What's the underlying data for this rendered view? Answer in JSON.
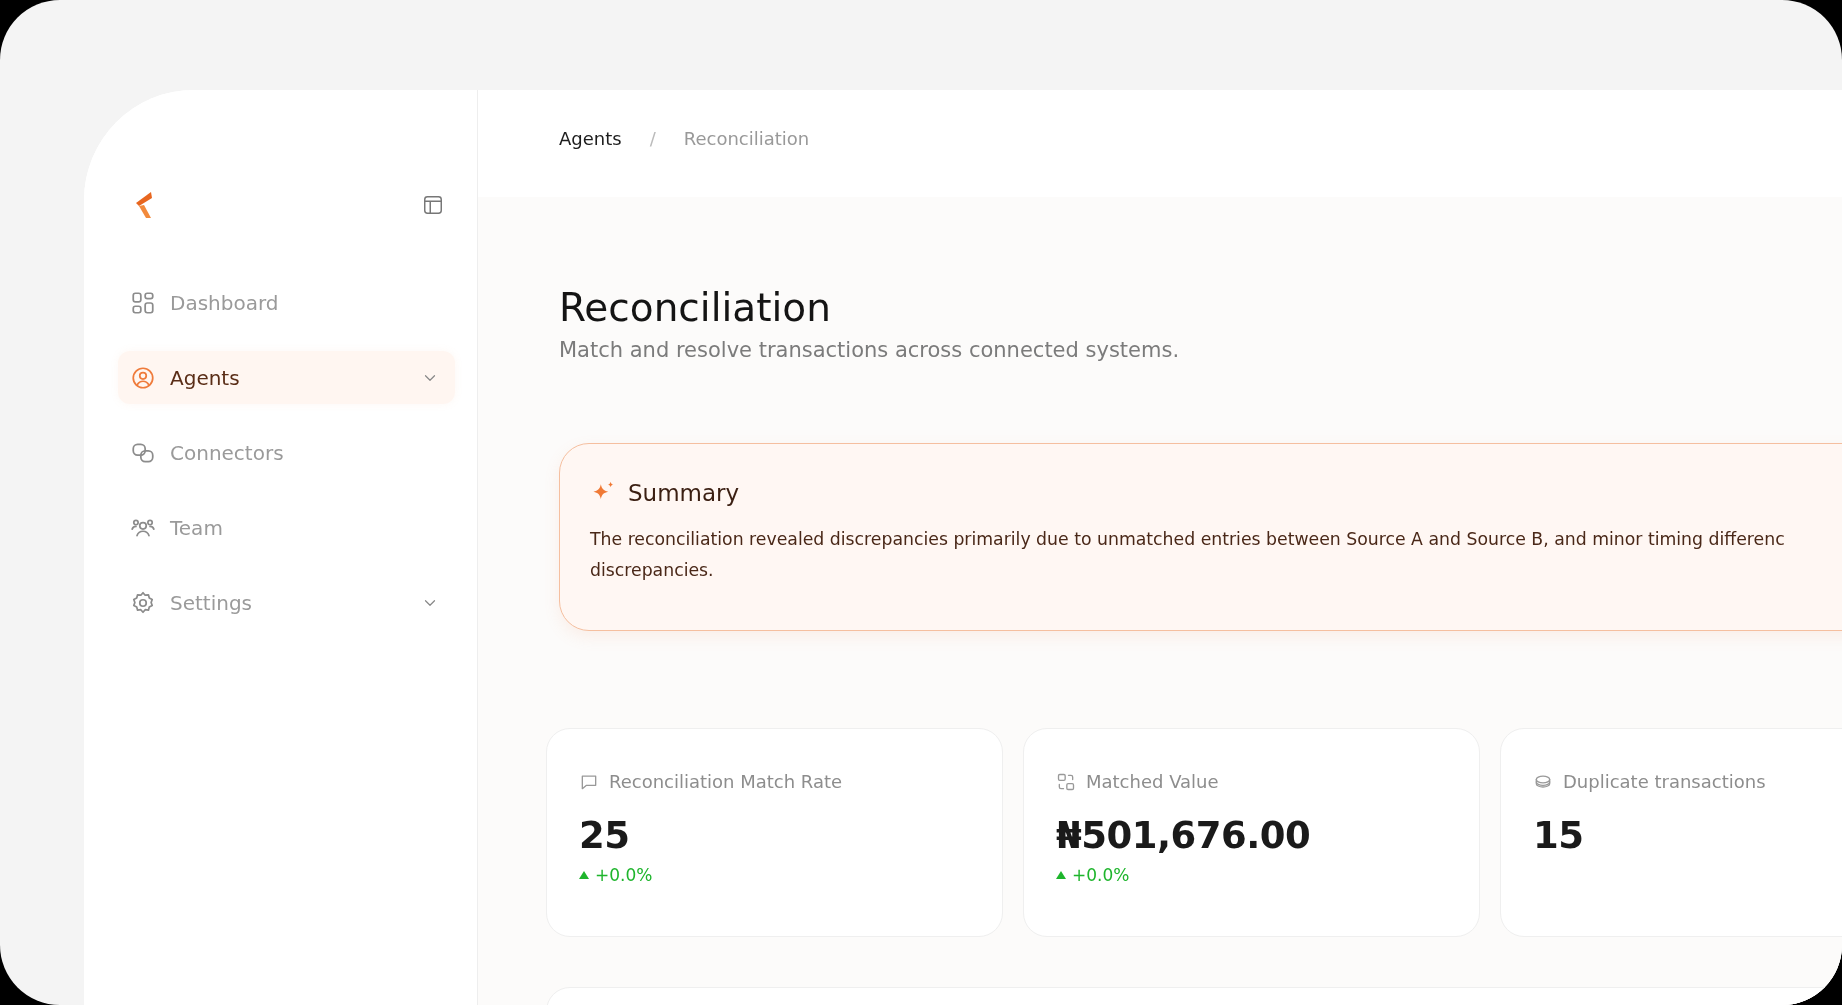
{
  "sidebar": {
    "items": [
      {
        "label": "Dashboard",
        "selected": false,
        "expandable": false
      },
      {
        "label": "Agents",
        "selected": true,
        "expandable": true
      },
      {
        "label": "Connectors",
        "selected": false,
        "expandable": false
      },
      {
        "label": "Team",
        "selected": false,
        "expandable": false
      },
      {
        "label": "Settings",
        "selected": false,
        "expandable": true
      }
    ]
  },
  "breadcrumb_separator": "/",
  "breadcrumb": [
    {
      "label": "Agents",
      "current": false
    },
    {
      "label": "Reconciliation",
      "current": true
    }
  ],
  "title": "Reconciliation",
  "subtitle": "Match and resolve transactions across connected systems.",
  "summary": {
    "title": "Summary",
    "lines": [
      "The reconciliation revealed discrepancies primarily due to unmatched entries between Source A and Source B, and minor timing differenc",
      "discrepancies."
    ]
  },
  "metrics": [
    {
      "label": "Reconciliation Match Rate",
      "value": "25",
      "delta": "+0.0%"
    },
    {
      "label": "Matched Value",
      "value": "₦501,676.00",
      "delta": "+0.0%"
    },
    {
      "label": "Duplicate transactions",
      "value": "15"
    }
  ]
}
